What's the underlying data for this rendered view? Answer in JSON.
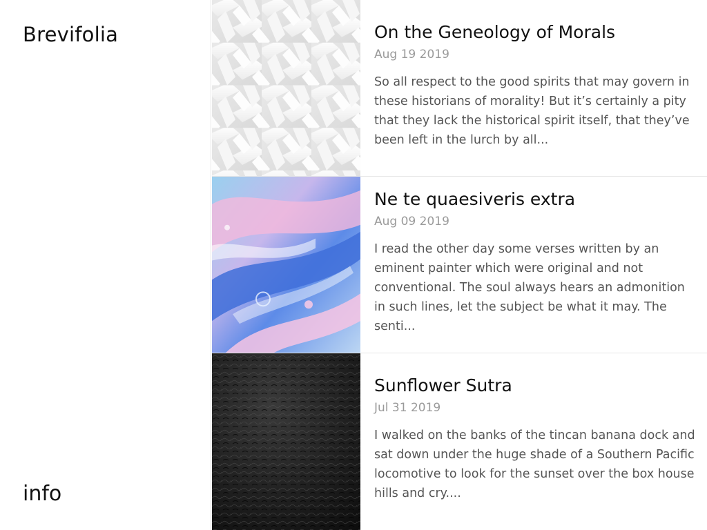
{
  "sidebar": {
    "site_title": "Brevifolia",
    "info_link": "info"
  },
  "posts": [
    {
      "title": "On the Geneology of Morals",
      "date": "Aug 19 2019",
      "excerpt": "So all respect to the good spirits that may govern in these historians of morality! But it’s certainly a pity that they lack the historical spirit itself, that they’ve been left in the lurch by all...",
      "thumbnail": "white-woven-pattern-image"
    },
    {
      "title": "Ne te quaesiveris extra",
      "date": "Aug 09 2019",
      "excerpt": "I read the other day some verses written by an eminent painter which were original and not conventional. The soul always hears an admonition in such lines, let the subject be what it may. The senti...",
      "thumbnail": "blue-pink-marble-image"
    },
    {
      "title": "Sunflower Sutra",
      "date": "Jul 31 2019",
      "excerpt": "I walked on the banks of the tincan banana dock and sat down under the huge shade of a Southern Pacific locomotive to look for the sunset over the box house hills and cry....",
      "thumbnail": "black-leather-texture-image"
    }
  ]
}
